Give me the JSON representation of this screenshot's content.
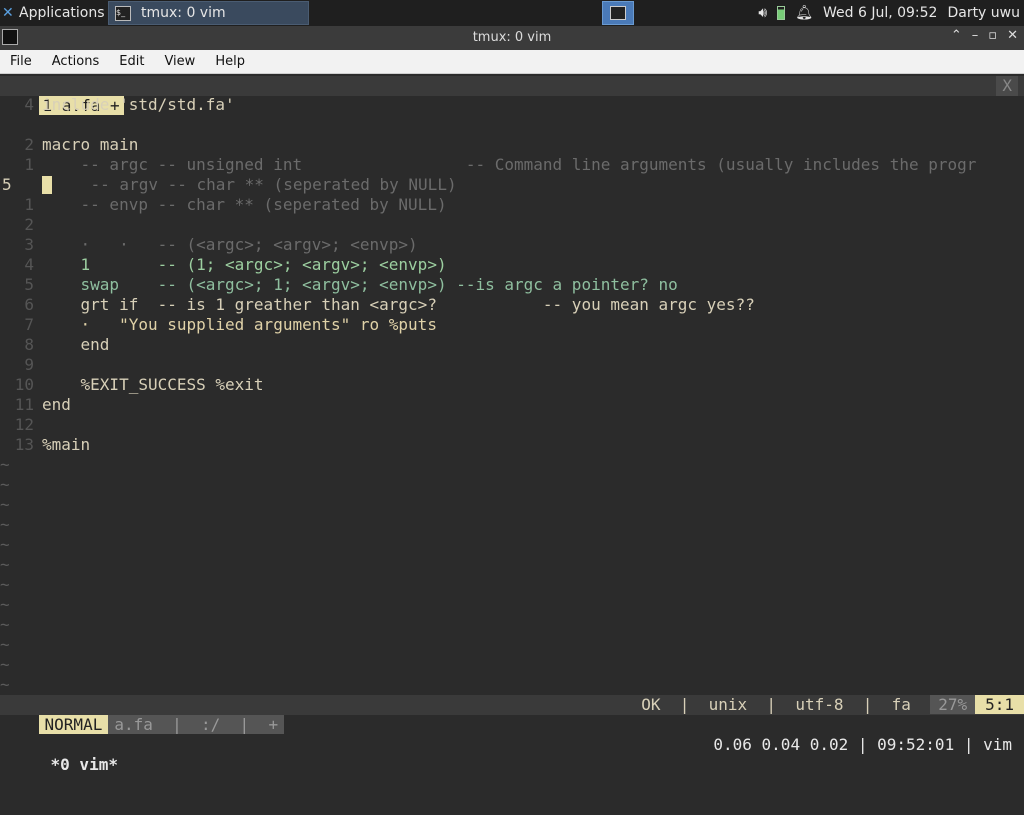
{
  "panel": {
    "applications_label": "Applications",
    "task_label": "tmux: 0 vim",
    "datetime": "Wed  6 Jul, 09:52",
    "user": "Darty uwu"
  },
  "window": {
    "title": "tmux: 0 vim",
    "menu": [
      "File",
      "Actions",
      "Edit",
      "View",
      "Help"
    ]
  },
  "vim": {
    "tab_label": "1 a.fa +",
    "tab_close": "X",
    "lines": [
      {
        "ln": "4",
        "text": "include 'std/std.fa'"
      },
      {
        "ln": "",
        "text": ""
      },
      {
        "ln": "2",
        "text": "macro main"
      },
      {
        "ln": "1",
        "text": "    -- argc -- unsigned int                 -- Command line arguments (usually includes the progr"
      },
      {
        "ln": "5",
        "text": "    -- argv -- char ** (seperated by NULL)"
      },
      {
        "ln": "1",
        "text": "    -- envp -- char ** (seperated by NULL)"
      },
      {
        "ln": "2",
        "text": ""
      },
      {
        "ln": "3",
        "text": "    ·   ·   -- (<argc>; <argv>; <envp>)"
      },
      {
        "ln": "4",
        "text": "    1       -- (1; <argc>; <argv>; <envp>)"
      },
      {
        "ln": "5",
        "text": "    swap    -- (<argc>; 1; <argv>; <envp>) --is argc a pointer? no"
      },
      {
        "ln": "6",
        "text": "    grt if  -- is 1 greather than <argc>?           -- you mean argc yes??"
      },
      {
        "ln": "7",
        "text": "    ·   \"You supplied arguments\" ro %puts"
      },
      {
        "ln": "8",
        "text": "    end"
      },
      {
        "ln": "9",
        "text": ""
      },
      {
        "ln": "10",
        "text": "    %EXIT_SUCCESS %exit"
      },
      {
        "ln": "11",
        "text": "end"
      },
      {
        "ln": "12",
        "text": ""
      },
      {
        "ln": "13",
        "text": "%main"
      }
    ],
    "tilde": "~",
    "status": {
      "mode": "NORMAL",
      "file": "a.fa  |  :/  |  +",
      "right": "OK  |  unix  |  utf-8  |  fa ",
      "percent": "27%",
      "position": "5:1"
    }
  },
  "tmux": {
    "left": "*0 vim*",
    "right": "0.06 0.04 0.02 | 09:52:01 | vim"
  },
  "colors": {
    "accent": "#e8dfa8",
    "background": "#2b2b2b",
    "comment": "#6b6b6b",
    "keyword_green": "#9ccfa0"
  }
}
